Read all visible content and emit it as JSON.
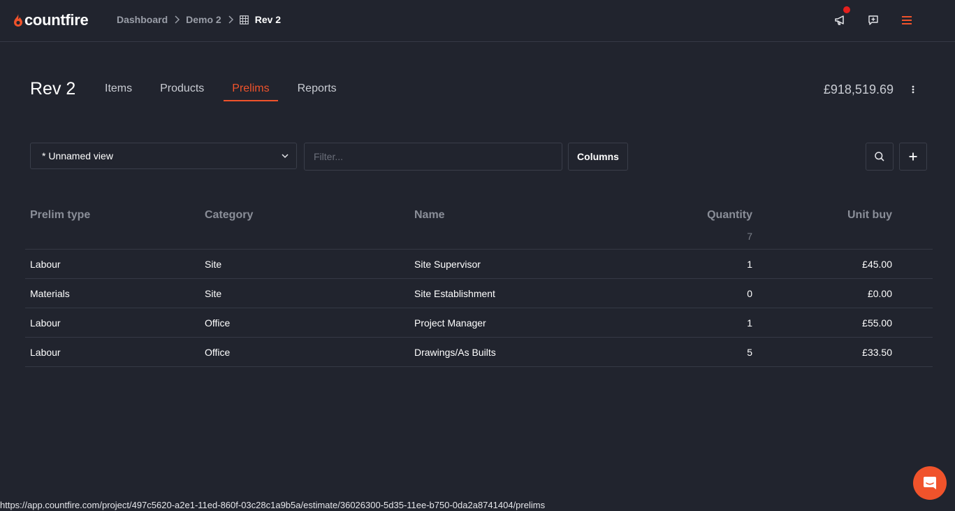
{
  "brand": {
    "name": "countfire",
    "accent": "#f0532b"
  },
  "breadcrumbs": {
    "items": [
      "Dashboard",
      "Demo 2"
    ],
    "current": "Rev 2"
  },
  "header": {
    "title": "Rev 2",
    "total": "£918,519.69"
  },
  "tabs": [
    {
      "label": "Items",
      "active": false
    },
    {
      "label": "Products",
      "active": false
    },
    {
      "label": "Prelims",
      "active": true
    },
    {
      "label": "Reports",
      "active": false
    }
  ],
  "toolbar": {
    "view_label": "* Unnamed view",
    "filter_placeholder": "Filter...",
    "filter_value": "",
    "columns_label": "Columns"
  },
  "table": {
    "columns": [
      "Prelim type",
      "Category",
      "Name",
      "Quantity",
      "Unit buy"
    ],
    "quantity_total": "7",
    "rows": [
      [
        "Labour",
        "Site",
        "Site Supervisor",
        "1",
        "£45.00"
      ],
      [
        "Materials",
        "Site",
        "Site Establishment",
        "0",
        "£0.00"
      ],
      [
        "Labour",
        "Office",
        "Project Manager",
        "1",
        "£55.00"
      ],
      [
        "Labour",
        "Office",
        "Drawings/As Builts",
        "5",
        "£33.50"
      ]
    ]
  },
  "status_url": "https://app.countfire.com/project/497c5620-a2e1-11ed-860f-03c28c1a9b5a/estimate/36026300-5d35-11ee-b750-0da2a8741404/prelims",
  "icons": [
    "flame-icon",
    "chevron-right-icon",
    "table-icon",
    "megaphone-icon",
    "feedback-icon",
    "menu-icon",
    "more-vertical-icon",
    "chevron-down-icon",
    "search-icon",
    "plus-icon",
    "chat-icon"
  ]
}
